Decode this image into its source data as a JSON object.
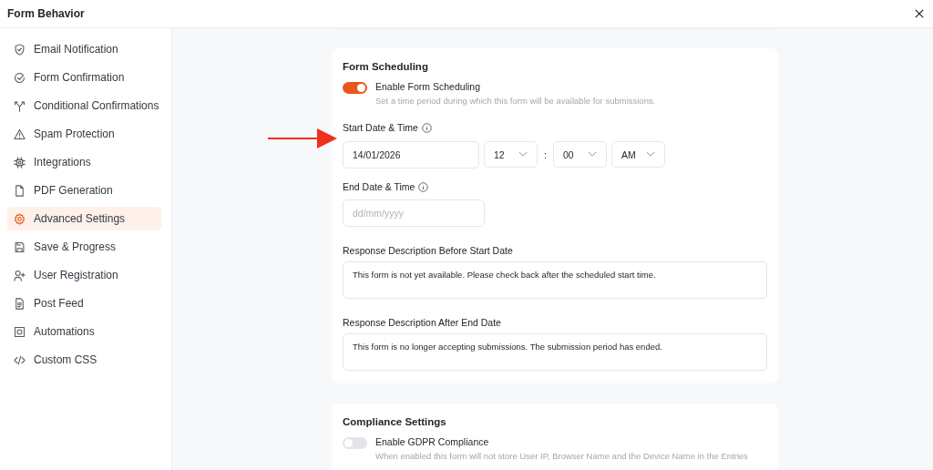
{
  "window": {
    "title": "Form Behavior"
  },
  "sidebar": {
    "items": [
      {
        "label": "Email Notification",
        "selected": false
      },
      {
        "label": "Form Confirmation",
        "selected": false
      },
      {
        "label": "Conditional Confirmations",
        "selected": false
      },
      {
        "label": "Spam Protection",
        "selected": false
      },
      {
        "label": "Integrations",
        "selected": false
      },
      {
        "label": "PDF Generation",
        "selected": false
      },
      {
        "label": "Advanced Settings",
        "selected": true
      },
      {
        "label": "Save & Progress",
        "selected": false
      },
      {
        "label": "User Registration",
        "selected": false
      },
      {
        "label": "Post Feed",
        "selected": false
      },
      {
        "label": "Automations",
        "selected": false
      },
      {
        "label": "Custom CSS",
        "selected": false
      }
    ]
  },
  "scheduling": {
    "title": "Form Scheduling",
    "toggle": {
      "label": "Enable Form Scheduling",
      "on": true,
      "description": "Set a time period during which this form will be available for submissions."
    },
    "start": {
      "label": "Start Date & Time",
      "date": "14/01/2026",
      "hour": "12",
      "separator": ":",
      "minute": "00",
      "period": "AM"
    },
    "end": {
      "label": "End Date & Time",
      "placeholder": "dd/mm/yyyy"
    },
    "before": {
      "label": "Response Description Before Start Date",
      "value": "This form is not yet available. Please check back after the scheduled start time."
    },
    "after": {
      "label": "Response Description After End Date",
      "value": "This form is no longer accepting submissions. The submission period has ended."
    }
  },
  "compliance": {
    "title": "Compliance Settings",
    "toggle": {
      "label": "Enable GDPR Compliance",
      "on": false,
      "description": "When enabled this form will not store User IP, Browser Name and the Device Name in the Entries"
    }
  }
}
